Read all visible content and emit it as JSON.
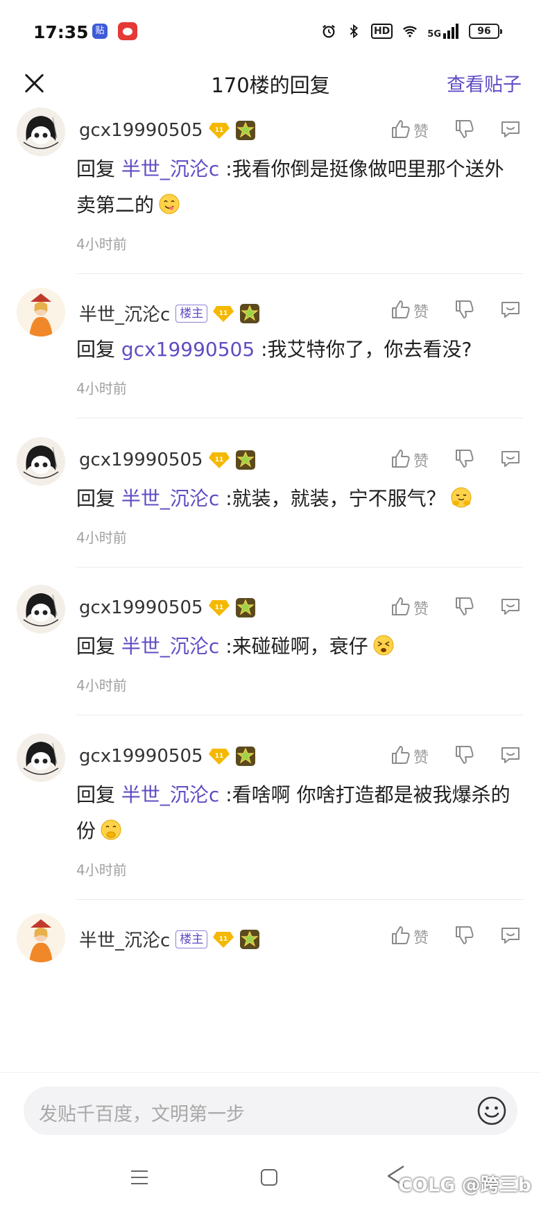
{
  "status_bar": {
    "time": "17:35",
    "app1_label": "贴",
    "icons": [
      "alarm-icon",
      "bluetooth-icon",
      "hd-icon",
      "wifi-icon",
      "signal-5g-icon"
    ],
    "hd": "HD",
    "net": "5G",
    "battery": "96"
  },
  "header": {
    "title": "170楼的回复",
    "view_post": "查看贴子"
  },
  "replies": [
    {
      "user": "gcx19990505",
      "is_host": false,
      "level": "11",
      "prefix": "回复",
      "reply_to": "半世_沉沦c",
      "text": ":我看你倒是挺像做吧里那个送外卖第二的",
      "emoji": "yum-emoji",
      "time": "4小时前"
    },
    {
      "user": "半世_沉沦c",
      "is_host": true,
      "level": "11",
      "prefix": "回复",
      "reply_to": "gcx19990505",
      "text": ":我艾特你了，你去看没?",
      "emoji": "",
      "time": "4小时前"
    },
    {
      "user": "gcx19990505",
      "is_host": false,
      "level": "11",
      "prefix": "回复",
      "reply_to": "半世_沉沦c",
      "text": ":就装，就装，宁不服气？",
      "emoji": "hug-emoji",
      "time": "4小时前"
    },
    {
      "user": "gcx19990505",
      "is_host": false,
      "level": "11",
      "prefix": "回复",
      "reply_to": "半世_沉沦c",
      "text": ":来碰碰啊，衰仔",
      "emoji": "squint-emoji",
      "time": "4小时前"
    },
    {
      "user": "gcx19990505",
      "is_host": false,
      "level": "11",
      "prefix": "回复",
      "reply_to": "半世_沉沦c",
      "text": ":看啥啊 你啥打造都是被我爆杀的份",
      "emoji": "giggle-emoji",
      "time": "4小时前"
    },
    {
      "user": "半世_沉沦c",
      "is_host": true,
      "level": "11",
      "prefix": "",
      "reply_to": "",
      "text": "",
      "emoji": "",
      "time": ""
    }
  ],
  "labels": {
    "host": "楼主",
    "like": "赞"
  },
  "input": {
    "placeholder": "发贴千百度，文明第一步"
  },
  "watermark": "COLG @跨三b",
  "colors": {
    "accent": "#614bc3",
    "muted": "#a0a0a0",
    "level_badge": "#f5b800"
  }
}
